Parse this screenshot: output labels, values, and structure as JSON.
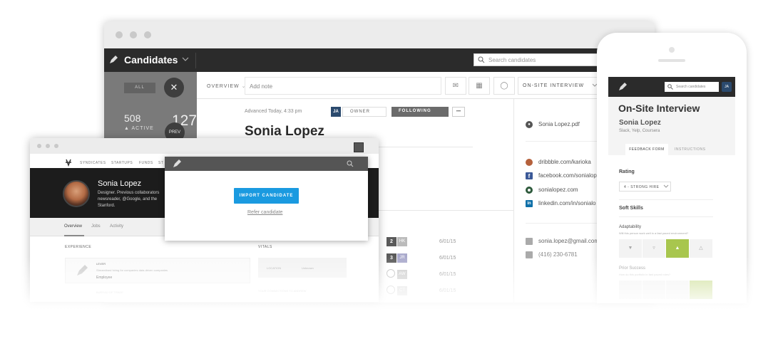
{
  "desktop": {
    "app_title": "Candidates",
    "search_placeholder": "Search candidates",
    "sidebar": {
      "filter_all": "ALL",
      "close_symbol": "✕",
      "active_count": "508",
      "active_label": "ACTIVE",
      "second_count": "127",
      "prev_label": "PREV"
    },
    "toolbar": {
      "overview_label": "OVERVIEW",
      "note_placeholder": "Add note",
      "stage_label": "ON-SITE INTERVIEW"
    },
    "candidate": {
      "meta": "Advanced Today, 4:33 pm",
      "owner_initials": "JA",
      "owner_label": "OWNER",
      "following_label": "FOLLOWING",
      "more_label": "•••",
      "name": "Sonia Lopez"
    },
    "feedback_rows": [
      {
        "count": "2",
        "initials": "HK",
        "date": "6/01/15",
        "color": "#5a5a5a"
      },
      {
        "count": "",
        "initials": "",
        "date": "6/01/15",
        "color": ""
      },
      {
        "count": "3",
        "initials": "JR",
        "date": "6/01/15",
        "color": "#5a5a5a"
      },
      {
        "count": "",
        "initials": "AW",
        "date": "6/01/15",
        "color": ""
      },
      {
        "count": "",
        "initials": "CT",
        "date": "6/01/15",
        "color": ""
      }
    ],
    "right_links": {
      "resume": "Sonia Lopez.pdf",
      "dribbble": "dribbble.com/karioka",
      "facebook": "facebook.com/sonialope",
      "website": "sonialopez.com",
      "linkedin": "linkedin.com/in/sonialo",
      "email": "sonia.lopez@gmail.com",
      "phone": "(416) 230-6781"
    }
  },
  "small_window": {
    "nav": [
      "SYNDICATES",
      "STARTUPS",
      "FUNDS",
      "ST"
    ],
    "profile_name": "Sonia Lopez",
    "profile_bio": "Designer. Previous collaborators newsreader, @Google, and the Stanford.",
    "tabs": [
      "Overview",
      "Jobs",
      "Activity"
    ],
    "experience_heading": "EXPERIENCE",
    "vitals_heading": "VITALS",
    "exp_company": "LEVER",
    "exp_desc": "Streamlined hiring for companies data-driven companies",
    "exp_role": "Employee",
    "exp_company2": "BUREAU OF TRADE",
    "vital_location_label": "LOCATION",
    "vital_location_value": "Unknown",
    "connections_label": "YOUR CONNECTIONS TO ANDREW"
  },
  "popup": {
    "import_label": "IMPORT CANDIDATE",
    "refer_label": "Refer candidate"
  },
  "phone": {
    "search_placeholder": "Search candidates",
    "user_initials": "JA",
    "stage_title": "On-Site Interview",
    "candidate_name": "Sonia Lopez",
    "candidate_sub": "Slack, Yelp, Coursera",
    "tab_feedback": "FEEDBACK FORM",
    "tab_instructions": "INSTRUCTIONS",
    "rating_heading": "Rating",
    "rating_value": "4 - STRONG HIRE",
    "soft_skills_heading": "Soft Skills",
    "skill1": "Adaptability",
    "skill1_q": "Will this person work well in a fast paced environment?",
    "skill2": "Prior Success",
    "skill2_q": "How do this portfolio in fast paced roles?"
  },
  "colors": {
    "topbar": "#2b2b2b",
    "accent_blue": "#1a9ae0",
    "accent_green": "#a8c64e",
    "owner_badge": "#2b4a6e"
  }
}
